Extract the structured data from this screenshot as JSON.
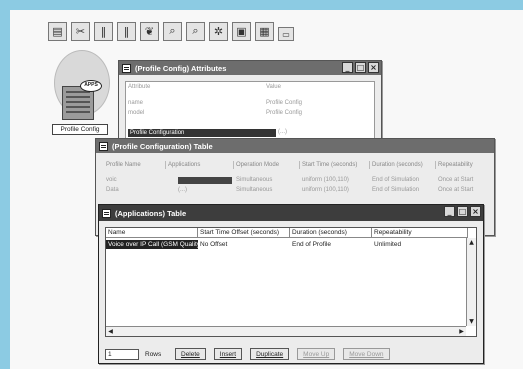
{
  "toolbar": {
    "buttons": [
      {
        "name": "open-icon",
        "glyph": "▤"
      },
      {
        "name": "scissors-icon",
        "glyph": "✂"
      },
      {
        "name": "bars-icon",
        "glyph": "‖"
      },
      {
        "name": "bars-alt-icon",
        "glyph": "‖"
      },
      {
        "name": "pin-icon",
        "glyph": "❦"
      },
      {
        "name": "zoom-in-icon",
        "glyph": "⌕"
      },
      {
        "name": "zoom-out-icon",
        "glyph": "⌕"
      },
      {
        "name": "network-icon",
        "glyph": "✲"
      },
      {
        "name": "window-icon",
        "glyph": "▣"
      },
      {
        "name": "monitor-icon",
        "glyph": "▦"
      },
      {
        "name": "panel-icon",
        "glyph": "▭"
      }
    ]
  },
  "desktop_icon": {
    "badge": "APPS",
    "label": "Profile Config"
  },
  "attributes_window": {
    "title": "(Profile Config) Attributes",
    "col_attribute": "Attribute",
    "col_value": "Value",
    "rows": [
      {
        "attr": "name",
        "value": "Profile Config"
      },
      {
        "attr": "model",
        "value": "Profile Config"
      }
    ],
    "selected_row": {
      "attr": "Profile Configuration",
      "value": "(...)"
    }
  },
  "profile_window": {
    "title": "(Profile Configuration) Table",
    "columns": [
      "Profile Name",
      "Applications",
      "Operation Mode",
      "Start Time (seconds)",
      "Duration (seconds)",
      "Repeatability"
    ],
    "rows": [
      [
        "voic",
        "",
        "Simultaneous",
        "uniform (100,110)",
        "End of Simulation",
        "Once at Start"
      ],
      [
        "Data",
        "(...)",
        "Simultaneous",
        "uniform (100,110)",
        "End of Simulation",
        "Once at Start"
      ]
    ]
  },
  "applications_window": {
    "title": "(Applications) Table",
    "columns": [
      "Name",
      "Start Time Offset (seconds)",
      "Duration (seconds)",
      "Repeatability"
    ],
    "rows": [
      [
        "Voice over IP Call (GSM Quality)",
        "No Offset",
        "End of Profile",
        "Unlimited"
      ]
    ],
    "rows_value": "1",
    "rows_label": "Rows",
    "buttons": {
      "delete": "Delete",
      "insert": "Insert",
      "duplicate": "Duplicate",
      "move_up": "Move Up",
      "move_down": "Move Down"
    }
  }
}
